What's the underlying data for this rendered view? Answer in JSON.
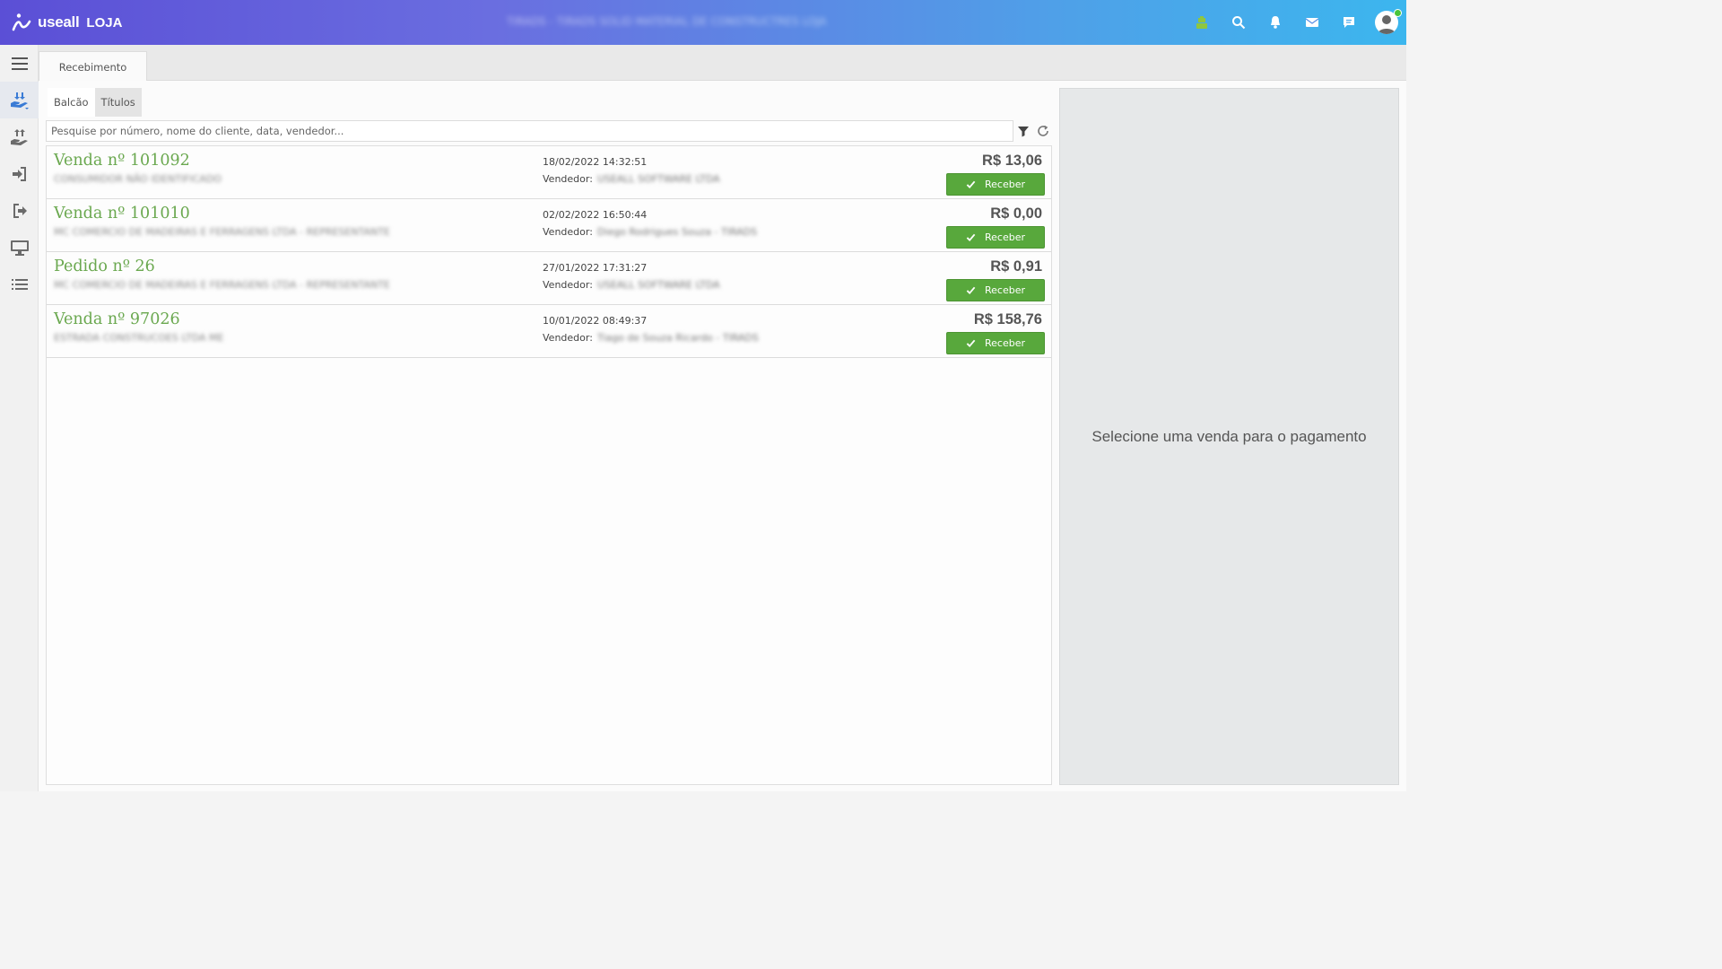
{
  "header": {
    "brand": "useall",
    "module": "LOJA",
    "store_name": "TIRADS - TIRADS SOLID MATERIAL DE CONSTRUCTRES LOJA"
  },
  "page_tab": "Recebimento",
  "subtabs": [
    "Balcão",
    "Títulos"
  ],
  "search": {
    "placeholder": "Pesquise por número, nome do cliente, data, vendedor..."
  },
  "sales": [
    {
      "title": "Venda nº 101092",
      "client": "CONSUMIDOR NÃO IDENTIFICADO",
      "date": "18/02/2022 14:32:51",
      "vendor_label": "Vendedor:",
      "vendor": "USEALL SOFTWARE LTDA",
      "amount": "R$ 13,06",
      "button": "Receber"
    },
    {
      "title": "Venda nº 101010",
      "client": "MC COMERCIO DE MADEIRAS E FERRAGENS LTDA - REPRESENTANTE",
      "date": "02/02/2022 16:50:44",
      "vendor_label": "Vendedor:",
      "vendor": "Diego Rodrigues Souza - TIRADS",
      "amount": "R$ 0,00",
      "button": "Receber"
    },
    {
      "title": "Pedido nº 26",
      "client": "MC COMERCIO DE MADEIRAS E FERRAGENS LTDA - REPRESENTANTE",
      "date": "27/01/2022 17:31:27",
      "vendor_label": "Vendedor:",
      "vendor": "USEALL SOFTWARE LTDA",
      "amount": "R$ 0,91",
      "button": "Receber"
    },
    {
      "title": "Venda nº 97026",
      "client": "ESTRADA CONSTRUCOES LTDA ME",
      "date": "10/01/2022 08:49:37",
      "vendor_label": "Vendedor:",
      "vendor": "Tiago de Souza Ricardo - TIRADS",
      "amount": "R$ 158,76",
      "button": "Receber"
    }
  ],
  "detail": {
    "message": "Selecione uma venda para o pagamento"
  },
  "colors": {
    "accent_green": "#6aa84f",
    "button_green": "#58a83c",
    "header_start": "#5b4fd6",
    "header_end": "#3cb6ee"
  }
}
